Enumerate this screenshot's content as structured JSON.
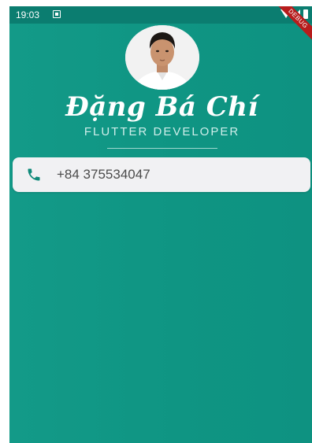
{
  "status_bar": {
    "time": "19:03",
    "debug_banner": "DEBUG"
  },
  "profile": {
    "name": "Đặng Bá Chí",
    "role": "FLUTTER DEVELOPER"
  },
  "contact": {
    "phone": "+84 375534047",
    "phone_icon": "phone-icon"
  },
  "colors": {
    "background": "#0f9583",
    "status_bar": "#0b7d70",
    "card": "#f1f1f3",
    "icon": "#0f8a7a"
  }
}
